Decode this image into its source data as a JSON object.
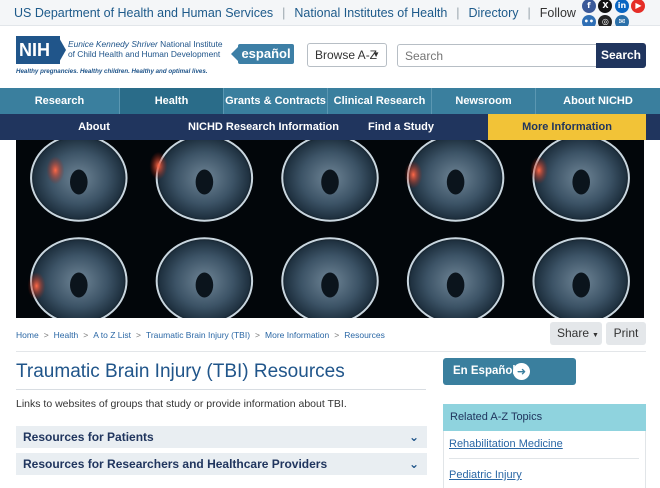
{
  "util_bar": {
    "links": [
      "US Department of Health and Human Services",
      "National Institutes of Health",
      "Directory"
    ],
    "follow_label": "Follow",
    "social": [
      {
        "icon": "facebook-icon",
        "color": "#3b5998",
        "glyph": "f"
      },
      {
        "icon": "x-icon",
        "color": "#111111",
        "glyph": "X"
      },
      {
        "icon": "linkedin-icon",
        "color": "#0a66c2",
        "glyph": "in"
      },
      {
        "icon": "youtube-icon",
        "color": "#e52d27",
        "glyph": "▶"
      },
      {
        "icon": "flickr-icon",
        "color": "#2f6fb5",
        "glyph": "••"
      },
      {
        "icon": "instagram-icon",
        "color": "#222222",
        "glyph": "◎"
      },
      {
        "icon": "email-icon",
        "color": "#2a6fa8",
        "glyph": "✉"
      }
    ]
  },
  "header": {
    "logo_mark": "NIH",
    "logo_line1_italic": "Eunice Kennedy Shriver",
    "logo_line1_rest": " National Institute",
    "logo_line2": "of Child Health and Human Development",
    "tagline": "Healthy pregnancies. Healthy children. Healthy and optimal lives.",
    "espanol_label": "español",
    "browse_label": "Browse A-Z",
    "search_placeholder": "Search",
    "search_button": "Search"
  },
  "nav_primary": [
    {
      "label": "Research",
      "active": false
    },
    {
      "label": "Health",
      "active": true
    },
    {
      "label": "Grants & Contracts",
      "active": false
    },
    {
      "label": "Clinical Research",
      "active": false
    },
    {
      "label": "Newsroom",
      "active": false
    },
    {
      "label": "About NICHD",
      "active": false
    }
  ],
  "nav_secondary": [
    {
      "label": "About",
      "active": false
    },
    {
      "label": "NICHD Research Information",
      "active": false
    },
    {
      "label": "Find a Study",
      "active": false
    },
    {
      "label": "More Information",
      "active": true
    }
  ],
  "colors": {
    "accent_blue": "#3a7f9e",
    "navy": "#20355e",
    "gold": "#f2c337",
    "teal": "#8fd3de",
    "link": "#2a67a5"
  },
  "breadcrumb": [
    "Home",
    "Health",
    "A to Z List",
    "Traumatic Brain Injury (TBI)",
    "More Information",
    "Resources"
  ],
  "actions": {
    "share_label": "Share",
    "print_label": "Print"
  },
  "main": {
    "title": "Traumatic Brain Injury (TBI) Resources",
    "intro": "Links to websites of groups that study or provide information about TBI.",
    "accordions": [
      "Resources for Patients",
      "Resources for Researchers and Healthcare Providers"
    ]
  },
  "sidebar": {
    "en_espanol_label": "En Español",
    "related_heading": "Related A-Z Topics",
    "related_links": [
      "Rehabilitation Medicine",
      "Pediatric Injury"
    ]
  }
}
